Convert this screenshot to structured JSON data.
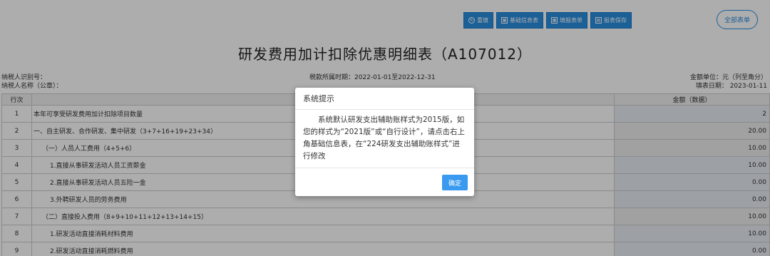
{
  "toolbar": {
    "reset_label": "重填",
    "basic_info_label": "基础信息表",
    "fill_form_label": "填报表单",
    "save_label": "报表保存",
    "all_forms_label": "全部表单"
  },
  "form": {
    "title": "研发费用加计扣除优惠明细表（A107012）",
    "taxpayer_id_label": "纳税人识别号：",
    "taxpayer_name_label": "纳税人名称（公章）：",
    "period_label": "税款所属时期：2022-01-01至2022-12-31",
    "unit_label": "金额单位：元（列至角分）",
    "fill_date_label": "填表日期： 2023-01-11"
  },
  "table": {
    "headers": [
      "行次",
      "",
      "金额（数据）"
    ],
    "rows": [
      {
        "num": "1",
        "name": "本年可享受研发费用加计扣除项目数量",
        "amount": "2",
        "indent": 0,
        "gray": false
      },
      {
        "num": "2",
        "name": "一、自主研发、合作研发、集中研发（3+7+16+19+23+34）",
        "amount": "20.00",
        "indent": 0,
        "gray": true
      },
      {
        "num": "3",
        "name": "（一）人员人工费用（4+5+6）",
        "amount": "10.00",
        "indent": 1,
        "gray": true
      },
      {
        "num": "4",
        "name": "1.直接从事研发活动人员工资薪金",
        "amount": "10.00",
        "indent": 2,
        "gray": false
      },
      {
        "num": "5",
        "name": "2.直接从事研发活动人员五险一金",
        "amount": "0.00",
        "indent": 2,
        "gray": false
      },
      {
        "num": "6",
        "name": "3.外聘研发人员的劳务费用",
        "amount": "0.00",
        "indent": 2,
        "gray": false
      },
      {
        "num": "7",
        "name": "（二）直接投入费用（8+9+10+11+12+13+14+15）",
        "amount": "10.00",
        "indent": 1,
        "gray": true
      },
      {
        "num": "8",
        "name": "1.研发活动直接消耗材料费用",
        "amount": "10.00",
        "indent": 2,
        "gray": false
      },
      {
        "num": "9",
        "name": "2.研发活动直接消耗燃料费用",
        "amount": "0.00",
        "indent": 2,
        "gray": false
      }
    ]
  },
  "dialog": {
    "title": "系统提示",
    "message": "系统默认研发支出辅助账样式为2015版，如您的样式为“2021版”或“自行设计”，请点击右上角基础信息表，在“224研发支出辅助账样式”进行修改",
    "ok_label": "确定"
  },
  "icons": {
    "reset": "reset-icon",
    "basic_info": "table-icon",
    "fill_form": "table-icon",
    "save": "save-icon"
  },
  "colors": {
    "primary": "#2a8ee0",
    "ok_button": "#3a9af0"
  }
}
